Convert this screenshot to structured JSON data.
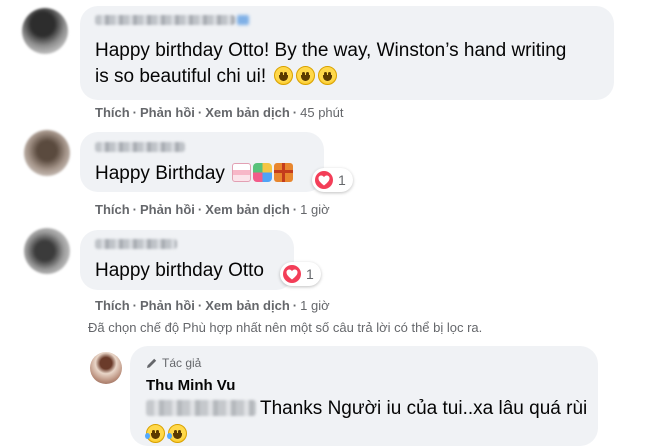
{
  "comments": [
    {
      "text": "Happy birthday Otto! By the way, Winston’s hand writing",
      "text_line2": "is so beautiful chi ui!",
      "emojis": [
        "grinning-face",
        "grinning-face",
        "grinning-face"
      ],
      "actions": {
        "like": "Thích",
        "reply": "Phản hồi",
        "translate": "Xem bản dịch",
        "time": "45 phút"
      }
    },
    {
      "text": "Happy Birthday",
      "emojis": [
        "birthday-cake",
        "party-popper",
        "wrapped-gift"
      ],
      "reactions": "1",
      "actions": {
        "like": "Thích",
        "reply": "Phản hồi",
        "translate": "Xem bản dịch",
        "time": "1 giờ"
      }
    },
    {
      "text": "Happy birthday Otto",
      "reactions": "1",
      "actions": {
        "like": "Thích",
        "reply": "Phản hồi",
        "translate": "Xem bản dịch",
        "time": "1 giờ"
      }
    }
  ],
  "filter_note": "Đã chọn chế độ Phù hợp nhất nên một số câu trả lời có thể bị lọc ra.",
  "reply": {
    "badge": "Tác giả",
    "author": "Thu Minh Vu",
    "text": "Thanks Người iu của tui..xa lâu quá rùi",
    "emojis": [
      "laughing-crying-face",
      "rolling-laughing-face"
    ]
  },
  "colors": {
    "bubble": "#f0f2f5",
    "meta": "#65676b",
    "heart": "#f33e58"
  }
}
